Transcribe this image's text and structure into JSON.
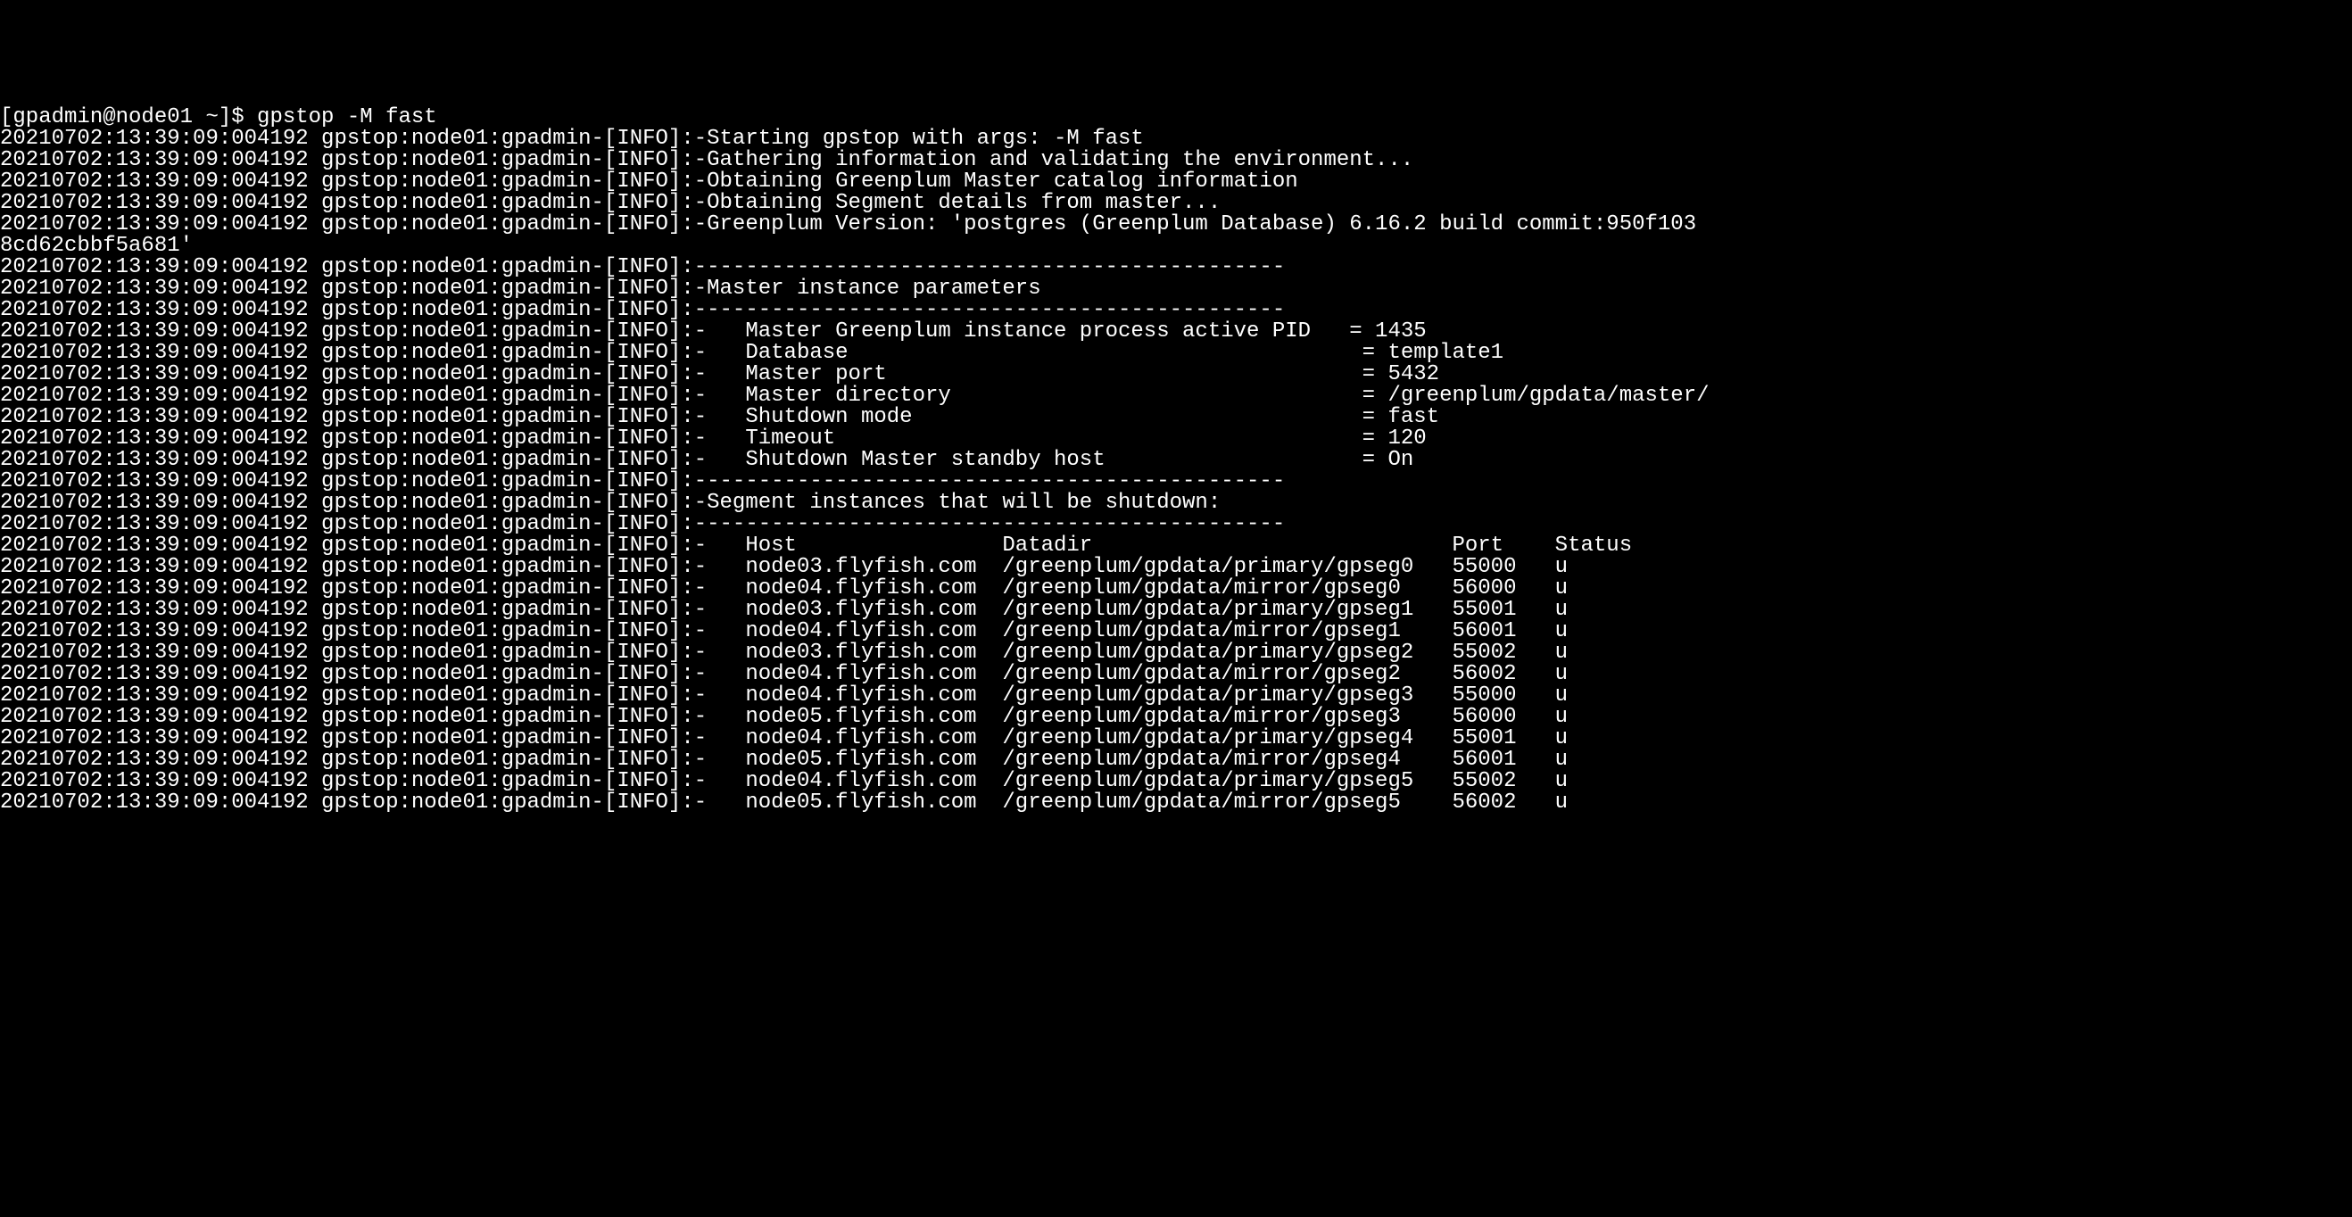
{
  "prompt": "[gpadmin@node01 ~]$ ",
  "command": "gpstop -M fast",
  "ts": "20210702:13:39:09:004192",
  "prefix_core": "gpstop:node01:gpadmin-[INFO]:-",
  "sep": "---------------------------------------------",
  "msgs": {
    "l1": "Starting gpstop with args: -M fast",
    "l2": "Gathering information and validating the environment...",
    "l3": "Obtaining Greenplum Master catalog information",
    "l4": "Obtaining Segment details from master...",
    "l5a": "Greenplum Version: 'postgres (Greenplum Database) 6.16.2 build commit:950f103",
    "l5b": "8cd62cbbf5a681'",
    "l7": "Master instance parameters"
  },
  "params": [
    {
      "label": "   Master Greenplum instance process active PID   ",
      "value": "= 1435"
    },
    {
      "label": "   Database                                        ",
      "value": "= template1"
    },
    {
      "label": "   Master port                                     ",
      "value": "= 5432"
    },
    {
      "label": "   Master directory                                ",
      "value": "= /greenplum/gpdata/master/"
    },
    {
      "label": "   Shutdown mode                                   ",
      "value": "= fast"
    },
    {
      "label": "   Timeout                                         ",
      "value": "= 120"
    },
    {
      "label": "   Shutdown Master standby host                    ",
      "value": "= On"
    }
  ],
  "seg_title": "Segment instances that will be shutdown:",
  "seg_header": {
    "host": "   Host                ",
    "datadir": "Datadir                            ",
    "port": "Port    ",
    "status": "Status"
  },
  "segments": [
    {
      "host": "   node03.flyfish.com  ",
      "datadir": "/greenplum/gpdata/primary/gpseg0   ",
      "port": "55000   ",
      "status": "u"
    },
    {
      "host": "   node04.flyfish.com  ",
      "datadir": "/greenplum/gpdata/mirror/gpseg0    ",
      "port": "56000   ",
      "status": "u"
    },
    {
      "host": "   node03.flyfish.com  ",
      "datadir": "/greenplum/gpdata/primary/gpseg1   ",
      "port": "55001   ",
      "status": "u"
    },
    {
      "host": "   node04.flyfish.com  ",
      "datadir": "/greenplum/gpdata/mirror/gpseg1    ",
      "port": "56001   ",
      "status": "u"
    },
    {
      "host": "   node03.flyfish.com  ",
      "datadir": "/greenplum/gpdata/primary/gpseg2   ",
      "port": "55002   ",
      "status": "u"
    },
    {
      "host": "   node04.flyfish.com  ",
      "datadir": "/greenplum/gpdata/mirror/gpseg2    ",
      "port": "56002   ",
      "status": "u"
    },
    {
      "host": "   node04.flyfish.com  ",
      "datadir": "/greenplum/gpdata/primary/gpseg3   ",
      "port": "55000   ",
      "status": "u"
    },
    {
      "host": "   node05.flyfish.com  ",
      "datadir": "/greenplum/gpdata/mirror/gpseg3    ",
      "port": "56000   ",
      "status": "u"
    },
    {
      "host": "   node04.flyfish.com  ",
      "datadir": "/greenplum/gpdata/primary/gpseg4   ",
      "port": "55001   ",
      "status": "u"
    },
    {
      "host": "   node05.flyfish.com  ",
      "datadir": "/greenplum/gpdata/mirror/gpseg4    ",
      "port": "56001   ",
      "status": "u"
    },
    {
      "host": "   node04.flyfish.com  ",
      "datadir": "/greenplum/gpdata/primary/gpseg5   ",
      "port": "55002   ",
      "status": "u"
    },
    {
      "host": "   node05.flyfish.com  ",
      "datadir": "/greenplum/gpdata/mirror/gpseg5    ",
      "port": "56002   ",
      "status": "u"
    }
  ]
}
